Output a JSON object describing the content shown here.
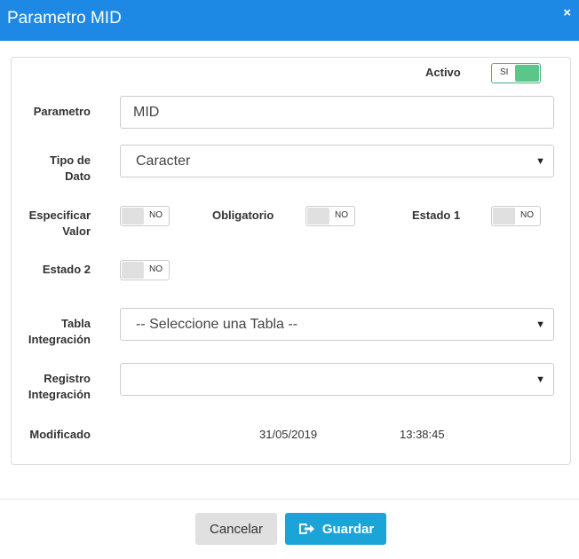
{
  "dialog": {
    "title": "Parametro MID",
    "close_glyph": "×"
  },
  "form": {
    "activo": {
      "label": "Activo",
      "toggle_text": "SI",
      "on": true
    },
    "parametro": {
      "label": "Parametro",
      "value": "MID"
    },
    "tipo_dato": {
      "label_line1": "Tipo de",
      "label_line2": "Dato",
      "value": "Caracter"
    },
    "especificar_valor": {
      "label_line1": "Especificar",
      "label_line2": "Valor",
      "toggle_text": "NO"
    },
    "obligatorio": {
      "label": "Obligatorio",
      "toggle_text": "NO"
    },
    "estado1": {
      "label": "Estado 1",
      "toggle_text": "NO"
    },
    "estado2": {
      "label": "Estado 2",
      "toggle_text": "NO"
    },
    "tabla_integracion": {
      "label_line1": "Tabla",
      "label_line2": "Integración",
      "value": "-- Seleccione una Tabla --"
    },
    "registro_integracion": {
      "label_line1": "Registro",
      "label_line2": "Integración",
      "value": ""
    },
    "modificado": {
      "label": "Modificado",
      "date": "31/05/2019",
      "time": "13:38:45"
    }
  },
  "footer": {
    "cancel_label": "Cancelar",
    "save_label": "Guardar"
  },
  "colors": {
    "header": "#1e88e5",
    "save_button": "#1ba4d8",
    "toggle_on": "#5cc68a",
    "cancel_button": "#e0e0e0"
  },
  "icons": {
    "save_icon": "save-arrow-icon",
    "close_icon": "close-icon",
    "dropdown_icon": "chevron-down-icon"
  }
}
